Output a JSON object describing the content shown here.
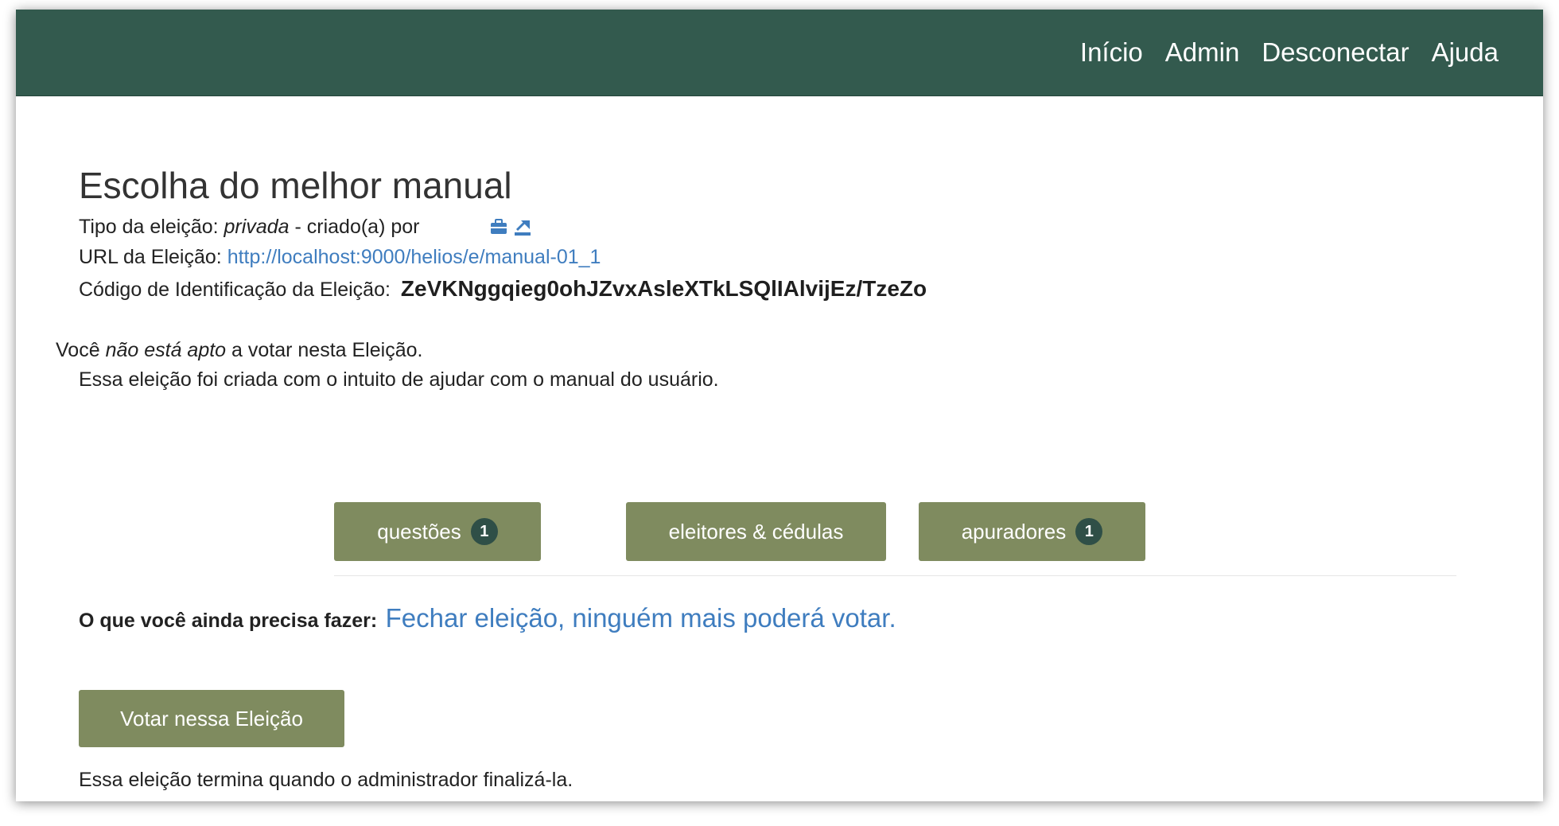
{
  "nav": {
    "items": [
      "Início",
      "Admin",
      "Desconectar",
      "Ajuda"
    ]
  },
  "election": {
    "title": "Escolha do melhor manual",
    "type_label": "Tipo da eleição:",
    "type_value": "privada",
    "created_by": "- criado(a) por",
    "url_label": "URL da Eleição:",
    "url": "http://localhost:9000/helios/e/manual-01_1",
    "id_label": "Código de Identificação da Eleição:",
    "id_code": "ZeVKNggqieg0ohJZvxAsleXTkLSQlIAlvijEz/TzeZo",
    "notice_before": "Você",
    "notice_em": "não está apto",
    "notice_after": "a votar nesta Eleição.",
    "description": "Essa eleição foi criada com o intuito de ajudar com o manual do usuário.",
    "todo_label": "O que você ainda precisa fazer:",
    "todo_link": "Fechar eleição, ninguém mais poderá votar.",
    "vote_button": "Votar nessa Eleição",
    "end_text": "Essa eleição termina quando o administrador finalizá-la."
  },
  "tabs": [
    {
      "label": "questões",
      "badge": "1"
    },
    {
      "label": "eleitores & cédulas"
    },
    {
      "label": "apuradores",
      "badge": "1"
    }
  ],
  "icons": [
    "briefcase-icon",
    "export-icon"
  ],
  "colors": {
    "navbar": "#335a4e",
    "button": "#7f8b5f",
    "badge": "#2f4f47",
    "link": "#3f7dbf"
  }
}
